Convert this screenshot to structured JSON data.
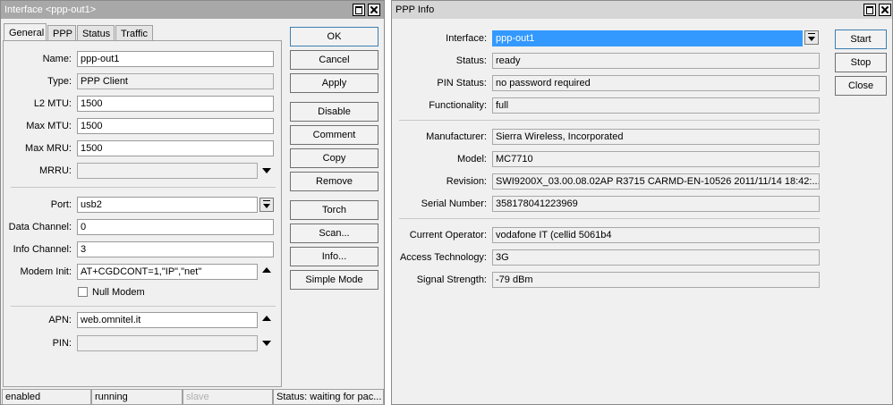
{
  "left_window": {
    "title": "Interface <ppp-out1>",
    "tabs": [
      "General",
      "PPP",
      "Status",
      "Traffic"
    ],
    "fields": {
      "name": {
        "label": "Name:",
        "value": "ppp-out1"
      },
      "type": {
        "label": "Type:",
        "value": "PPP Client"
      },
      "l2mtu": {
        "label": "L2 MTU:",
        "value": "1500"
      },
      "maxmtu": {
        "label": "Max MTU:",
        "value": "1500"
      },
      "maxmru": {
        "label": "Max MRU:",
        "value": "1500"
      },
      "mrru": {
        "label": "MRRU:",
        "value": ""
      },
      "port": {
        "label": "Port:",
        "value": "usb2"
      },
      "data_channel": {
        "label": "Data Channel:",
        "value": "0"
      },
      "info_channel": {
        "label": "Info Channel:",
        "value": "3"
      },
      "modem_init": {
        "label": "Modem Init:",
        "value": "AT+CGDCONT=1,\"IP\",\"net\""
      },
      "null_modem": {
        "label": "Null Modem"
      },
      "apn": {
        "label": "APN:",
        "value": "web.omnitel.it"
      },
      "pin": {
        "label": "PIN:",
        "value": ""
      }
    },
    "buttons": [
      "OK",
      "Cancel",
      "Apply",
      "Disable",
      "Comment",
      "Copy",
      "Remove",
      "Torch",
      "Scan...",
      "Info...",
      "Simple Mode"
    ],
    "statusbar": [
      "enabled",
      "running",
      "slave",
      "Status: waiting for pac..."
    ]
  },
  "right_window": {
    "title": "PPP Info",
    "fields": {
      "interface": {
        "label": "Interface:",
        "value": "ppp-out1"
      },
      "status": {
        "label": "Status:",
        "value": "ready"
      },
      "pin_status": {
        "label": "PIN Status:",
        "value": "no password required"
      },
      "functionality": {
        "label": "Functionality:",
        "value": "full"
      },
      "manufacturer": {
        "label": "Manufacturer:",
        "value": "Sierra Wireless, Incorporated"
      },
      "model": {
        "label": "Model:",
        "value": "MC7710"
      },
      "revision": {
        "label": "Revision:",
        "value": "SWI9200X_03.00.08.02AP R3715 CARMD-EN-10526 2011/11/14 18:42:..."
      },
      "serial": {
        "label": "Serial Number:",
        "value": "358178041223969"
      },
      "operator": {
        "label": "Current Operator:",
        "value": "vodafone IT (cellid 5061b4"
      },
      "access_tech": {
        "label": "Access Technology:",
        "value": "3G"
      },
      "signal": {
        "label": "Signal Strength:",
        "value": "-79 dBm"
      }
    },
    "buttons": [
      "Start",
      "Stop",
      "Close"
    ]
  },
  "colors": {
    "titlebar_inactive": "#a8a8a8",
    "selection": "#3399ff",
    "window_bg": "#f0f0f0"
  }
}
